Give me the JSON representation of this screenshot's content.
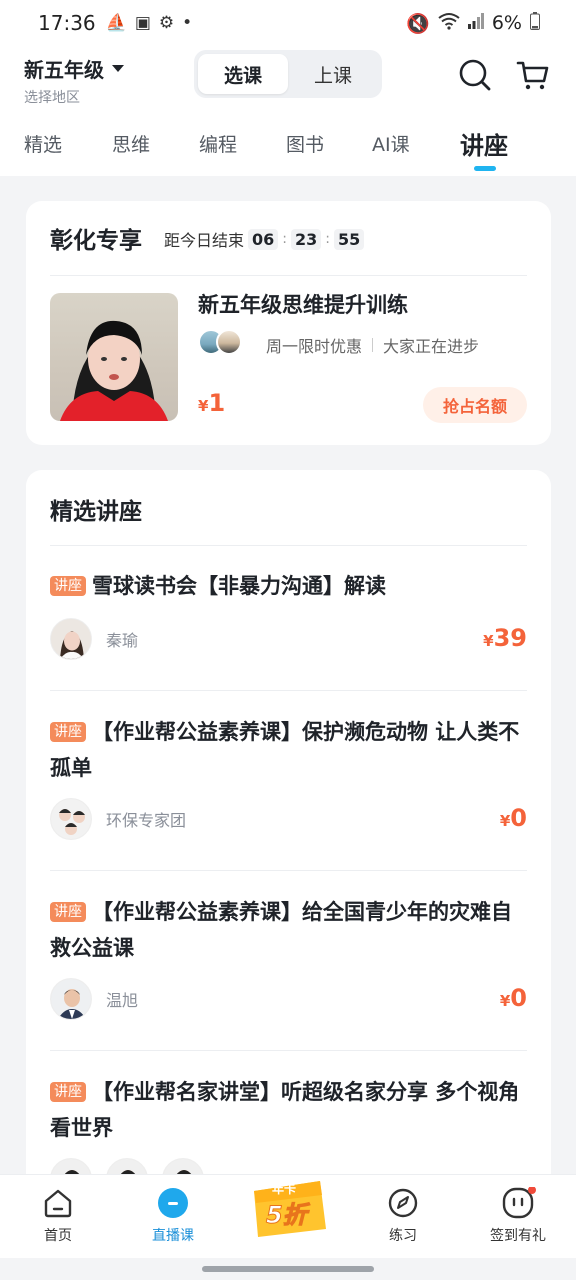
{
  "status_bar": {
    "time": "17:36",
    "battery": "6%"
  },
  "header": {
    "grade": "新五年级",
    "region_hint": "选择地区",
    "switch": [
      {
        "label": "选课",
        "active": true
      },
      {
        "label": "上课",
        "active": false
      }
    ],
    "icons": [
      "search-icon",
      "cart-icon"
    ]
  },
  "tabs": [
    {
      "label": "精选"
    },
    {
      "label": "思维"
    },
    {
      "label": "编程"
    },
    {
      "label": "图书"
    },
    {
      "label": "AI课"
    },
    {
      "label": "讲座",
      "active": true
    }
  ],
  "promo": {
    "title": "彰化专享",
    "countdown_label": "距今日结束",
    "countdown": {
      "h": "06",
      "m": "23",
      "s": "55"
    },
    "course_title": "新五年级思维提升训练",
    "tag1": "周一限时优惠",
    "tag2": "大家正在进步",
    "currency": "¥",
    "price": "1",
    "button": "抢占名额"
  },
  "lectures": {
    "title": "精选讲座",
    "badge": "讲座",
    "currency": "¥",
    "items": [
      {
        "title": "雪球读书会【非暴力沟通】解读",
        "teacher": "秦瑜",
        "price": "39"
      },
      {
        "title": "【作业帮公益素养课】保护濒危动物 让人类不孤单",
        "teacher": "环保专家团",
        "price": "0"
      },
      {
        "title": "【作业帮公益素养课】给全国青少年的灾难自救公益课",
        "teacher": "温旭",
        "price": "0"
      },
      {
        "title": "【作业帮名家讲堂】听超级名家分享 多个视角看世界",
        "teacher": "",
        "price": ""
      }
    ]
  },
  "bottom_nav": {
    "items": [
      {
        "label": "首页",
        "icon": "home-icon"
      },
      {
        "label": "直播课",
        "icon": "live-class-icon",
        "active": true
      },
      {
        "label": "",
        "icon": "year-card-promo-icon"
      },
      {
        "label": "练习",
        "icon": "practice-icon"
      },
      {
        "label": "签到有礼",
        "icon": "checkin-icon"
      }
    ],
    "promo_badge": {
      "top": "年卡",
      "main": "5折"
    }
  },
  "colors": {
    "accent": "#1fb4f0",
    "price": "#f4633a",
    "badge": "#f48b5b"
  }
}
